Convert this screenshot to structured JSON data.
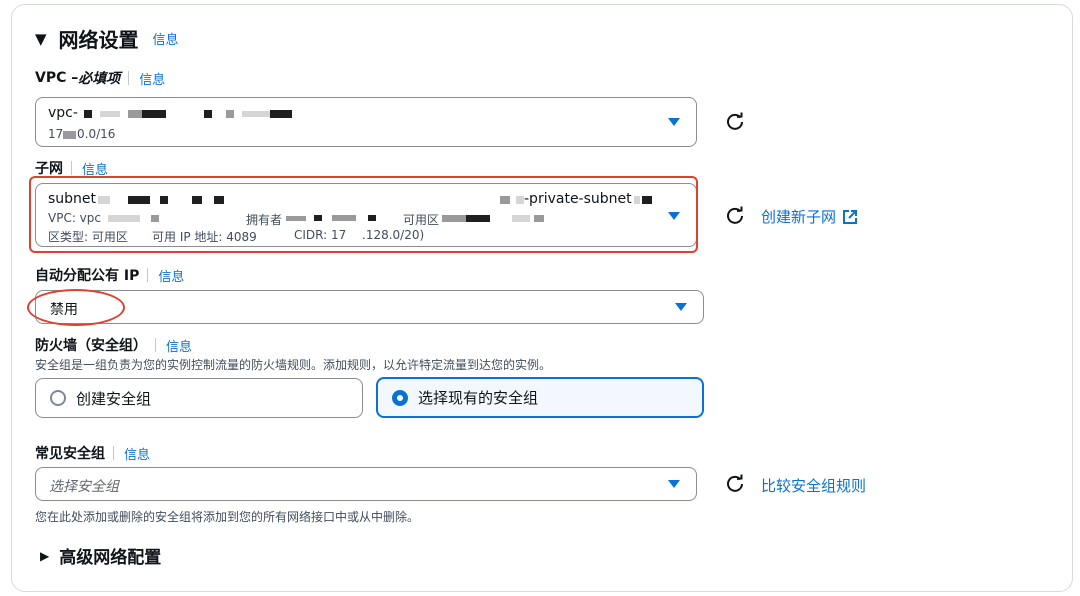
{
  "network_settings": {
    "title": "网络设置",
    "info": "信息"
  },
  "vpc": {
    "label": "VPC – ",
    "label_required": "必填项",
    "info": "信息",
    "value_prefix": "vpc-",
    "cidr_prefix": "17",
    "cidr_suffix": "0.0/16"
  },
  "subnet": {
    "label": "子网",
    "info": "信息",
    "value_prefix": "subnet",
    "name_suffix": "-private-subnet",
    "vpc_prefix": "VPC: vpc",
    "owner": "拥有者",
    "az": "可用区",
    "zone_type": "区类型: 可用区",
    "available_ip": "可用 IP 地址: 4089",
    "cidr_a": "CIDR: 17",
    "cidr_b": ".128.0/20)",
    "create_link": "创建新子网"
  },
  "auto_ip": {
    "label": "自动分配公有 IP",
    "info": "信息",
    "value": "禁用"
  },
  "firewall": {
    "label": "防火墙（安全组）",
    "info": "信息",
    "description": "安全组是一组负责为您的实例控制流量的防火墙规则。添加规则，以允许特定流量到达您的实例。",
    "option_create": "创建安全组",
    "option_existing": "选择现有的安全组"
  },
  "common_sg": {
    "label": "常见安全组",
    "info": "信息",
    "placeholder": "选择安全组",
    "compare_link": "比较安全组规则",
    "hint": "您在此处添加或删除的安全组将添加到您的所有网络接口中或从中删除。"
  },
  "advanced": {
    "label": "高级网络配置"
  },
  "colors": {
    "accent": "#0972d3",
    "annotation": "#e0402f",
    "border": "#8c8c94"
  }
}
